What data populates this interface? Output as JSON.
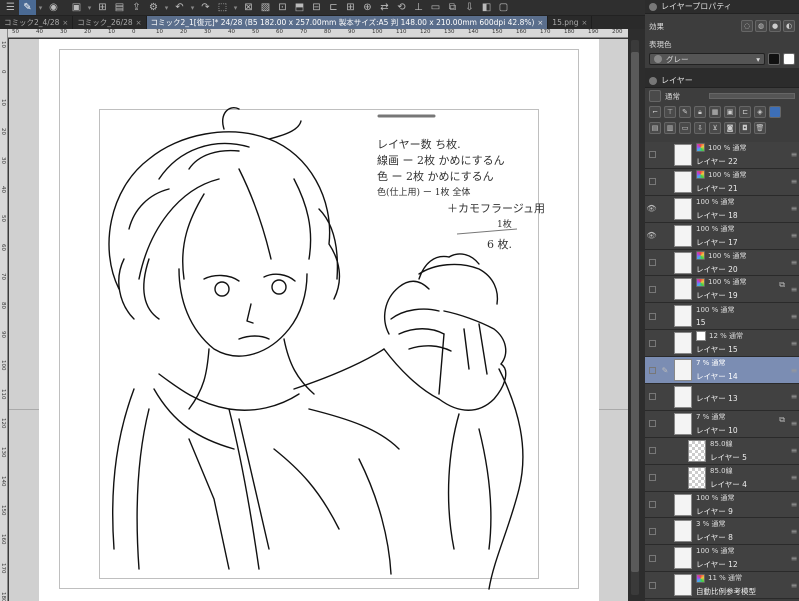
{
  "tabs": [
    {
      "label": "コミック2_4/28",
      "active": false
    },
    {
      "label": "コミック_26/28",
      "active": false
    },
    {
      "label": "コミック2_1[復元]* 24/28 (B5 182.00 x 257.00mm 製本サイズ:A5 判 148.00 x 210.00mm 600dpi 42.8%)",
      "active": true
    },
    {
      "label": "15.png",
      "active": false
    }
  ],
  "ruler_ticks": [
    "50",
    "40",
    "30",
    "20",
    "10",
    "0",
    "10",
    "20",
    "30",
    "40",
    "50",
    "60",
    "70",
    "80",
    "90",
    "100",
    "110",
    "120",
    "130",
    "140",
    "150",
    "160",
    "170",
    "180",
    "190",
    "200"
  ],
  "ruler_left_ticks": [
    "10",
    "0",
    "10",
    "20",
    "30",
    "40",
    "50",
    "60",
    "70",
    "80",
    "90",
    "100",
    "110",
    "120",
    "130",
    "140",
    "150",
    "160",
    "170",
    "180"
  ],
  "note_lines": [
    "レイヤー数 ち枚.",
    "線画 ー 2枚 かめにするん",
    "色 ー 2枚 かめにするん",
    "色(仕上用) ー 1枚 全体",
    "＋カモフラージュ用",
    "1枚",
    "6 枚."
  ],
  "property_panel": {
    "title": "レイヤープロパティ",
    "effect_label": "効果",
    "color_label": "表現色",
    "color_value": "グレー"
  },
  "layer_panel": {
    "title": "レイヤー",
    "blend_mode": "通常"
  },
  "layers": [
    {
      "opacity": "100 % 通常",
      "name": "レイヤー 22",
      "eye": false,
      "color": true,
      "thumb": "plain",
      "selected": false
    },
    {
      "opacity": "100 % 通常",
      "name": "レイヤー 21",
      "eye": false,
      "color": true,
      "thumb": "plain",
      "selected": false
    },
    {
      "opacity": "100 % 通常",
      "name": "レイヤー 18",
      "eye": true,
      "color": false,
      "thumb": "plain",
      "selected": false
    },
    {
      "opacity": "100 % 通常",
      "name": "レイヤー 17",
      "eye": true,
      "color": false,
      "thumb": "plain",
      "selected": false
    },
    {
      "opacity": "100 % 通常",
      "name": "レイヤー 20",
      "eye": false,
      "color": true,
      "thumb": "plain",
      "selected": false
    },
    {
      "opacity": "100 % 通常",
      "name": "レイヤー 19",
      "eye": false,
      "color": true,
      "thumb": "plain",
      "selected": false,
      "ref": true
    },
    {
      "opacity": "100 % 通常",
      "name": "15",
      "eye": false,
      "color": false,
      "thumb": "plain",
      "selected": false
    },
    {
      "opacity": "12 % 通常",
      "name": "レイヤー 15",
      "eye": false,
      "color": false,
      "thumb": "plain",
      "selected": false,
      "mask": true
    },
    {
      "opacity": "7 % 通常",
      "name": "レイヤー 14",
      "eye": false,
      "color": false,
      "thumb": "plain",
      "selected": true,
      "pen": true
    },
    {
      "opacity": "",
      "name": "レイヤー 13",
      "eye": false,
      "color": false,
      "thumb": "plain",
      "selected": false
    },
    {
      "opacity": "7 % 通常",
      "name": "レイヤー 10",
      "eye": false,
      "color": false,
      "thumb": "plain",
      "selected": false,
      "ref": true
    },
    {
      "opacity": "85.0線",
      "name": "レイヤー 5",
      "eye": false,
      "color": false,
      "thumb": "checker",
      "selected": false,
      "indent": true
    },
    {
      "opacity": "85.0線",
      "name": "レイヤー 4",
      "eye": false,
      "color": false,
      "thumb": "checker",
      "selected": false,
      "indent": true
    },
    {
      "opacity": "100 % 通常",
      "name": "レイヤー 9",
      "eye": false,
      "color": false,
      "thumb": "plain",
      "selected": false
    },
    {
      "opacity": "3 % 通常",
      "name": "レイヤー 8",
      "eye": false,
      "color": false,
      "thumb": "plain",
      "selected": false
    },
    {
      "opacity": "100 % 通常",
      "name": "レイヤー 12",
      "eye": false,
      "color": false,
      "thumb": "plain",
      "selected": false
    },
    {
      "opacity": "11 % 通常",
      "name": "自動比例参考模型",
      "eye": false,
      "color": true,
      "thumb": "plain",
      "selected": false,
      "special": true
    }
  ]
}
